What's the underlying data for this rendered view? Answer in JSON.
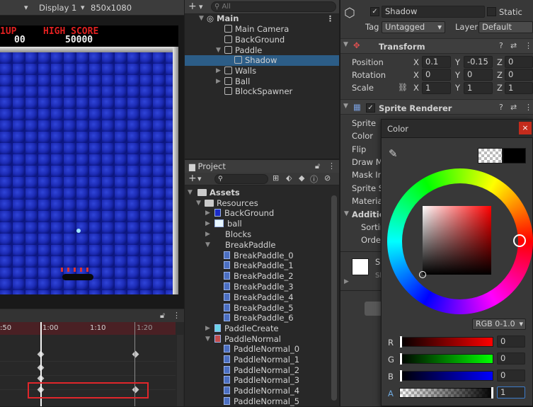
{
  "game_view": {
    "display": "Display 1",
    "resolution": "850x1080",
    "hud": {
      "one_up": "1UP",
      "high_score_label": "HIGH SCORE",
      "score": "00",
      "high_score": "50000"
    }
  },
  "animation": {
    "ticks": [
      ":50",
      "1:00",
      "1:10",
      "1:20"
    ]
  },
  "hierarchy": {
    "search_placeholder": "All",
    "scene": "Main",
    "items": [
      "Main Camera",
      "BackGround",
      "Paddle",
      "Shadow",
      "Walls",
      "Ball",
      "BlockSpawner"
    ]
  },
  "project": {
    "tab": "Project",
    "root": "Assets",
    "resources": "Resources",
    "items": [
      "BackGround",
      "ball",
      "Blocks",
      "BreakPaddle"
    ],
    "break_paddle": [
      "BreakPaddle_0",
      "BreakPaddle_1",
      "BreakPaddle_2",
      "BreakPaddle_3",
      "BreakPaddle_4",
      "BreakPaddle_5",
      "BreakPaddle_6"
    ],
    "paddle_create": "PaddleCreate",
    "paddle_normal": "PaddleNormal",
    "paddle_normal_items": [
      "PaddleNormal_0",
      "PaddleNormal_1",
      "PaddleNormal_2",
      "PaddleNormal_3",
      "PaddleNormal_4",
      "PaddleNormal_5"
    ]
  },
  "inspector": {
    "name": "Shadow",
    "static_label": "Static",
    "tag_label": "Tag",
    "tag": "Untagged",
    "layer_label": "Layer",
    "layer": "Default",
    "transform": {
      "title": "Transform",
      "position_label": "Position",
      "rotation_label": "Rotation",
      "scale_label": "Scale",
      "position": {
        "x": "0.1",
        "y": "-0.15",
        "z": "0"
      },
      "rotation": {
        "x": "0",
        "y": "0",
        "z": "0"
      },
      "scale": {
        "x": "1",
        "y": "1",
        "z": "1"
      }
    },
    "sprite_renderer": {
      "title": "Sprite Renderer",
      "labels": [
        "Sprite",
        "Color",
        "Flip",
        "Draw M",
        "Mask In",
        "Sprite S",
        "Materia"
      ],
      "additional": "Additio",
      "sorting": "Sortin",
      "order": "Order",
      "lower_s": "S",
      "lower_sh": "Sh"
    }
  },
  "color_picker": {
    "title": "Color",
    "mode": "RGB 0-1.0",
    "r": "0",
    "g": "0",
    "b": "0",
    "a": "1",
    "r_label": "R",
    "g_label": "G",
    "b_label": "B",
    "a_label": "A"
  }
}
